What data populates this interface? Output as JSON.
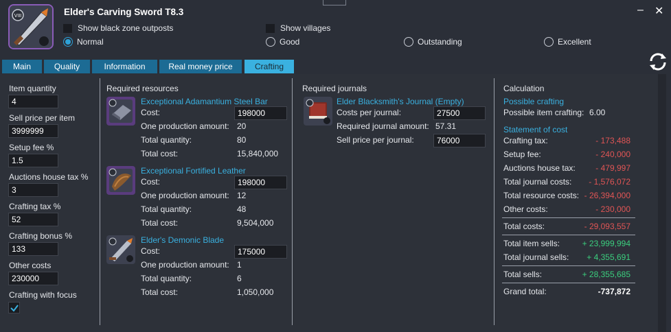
{
  "window": {
    "title": "Elder's Carving Sword T8.3",
    "tier_badge": "VIII",
    "minimize_glyph": "‒",
    "close_glyph": "✕"
  },
  "options": {
    "show_black_zone": "Show black zone outposts",
    "show_villages": "Show villages",
    "qualities": [
      "Normal",
      "Good",
      "Outstanding",
      "Excellent"
    ],
    "selected_quality": "Normal"
  },
  "tabs": [
    "Main",
    "Quality",
    "Information",
    "Real money price",
    "Crafting"
  ],
  "active_tab": "Crafting",
  "left": {
    "item_quantity_label": "Item quantity",
    "item_quantity": "4",
    "sell_price_label": "Sell price per item",
    "sell_price": "3999999",
    "setup_fee_label": "Setup fee %",
    "setup_fee": "1.5",
    "auction_tax_label": "Auctions house tax %",
    "auction_tax": "3",
    "crafting_tax_label": "Crafting tax %",
    "crafting_tax": "52",
    "crafting_bonus_label": "Crafting bonus %",
    "crafting_bonus": "133",
    "other_costs_label": "Other costs",
    "other_costs": "230000",
    "focus_label": "Crafting with focus",
    "focus_checked": true
  },
  "resources": {
    "heading": "Required resources",
    "cost_label": "Cost:",
    "one_prod_label": "One production amount:",
    "total_qty_label": "Total quantity:",
    "total_cost_label": "Total cost:",
    "items": [
      {
        "name": "Exceptional Adamantium Steel Bar",
        "cost": "198000",
        "one_prod": "20",
        "total_qty": "80",
        "total_cost": "15,840,000",
        "icon": "steel-bar-icon"
      },
      {
        "name": "Exceptional Fortified Leather",
        "cost": "198000",
        "one_prod": "12",
        "total_qty": "48",
        "total_cost": "9,504,000",
        "icon": "leather-icon"
      },
      {
        "name": "Elder's Demonic Blade",
        "cost": "175000",
        "one_prod": "1",
        "total_qty": "6",
        "total_cost": "1,050,000",
        "icon": "demonic-blade-icon"
      }
    ]
  },
  "journals": {
    "heading": "Required journals",
    "name": "Elder Blacksmith's Journal (Empty)",
    "cost_label": "Costs per journal:",
    "cost": "27500",
    "amount_label": "Required journal amount:",
    "amount": "57.31",
    "sell_label": "Sell price per journal:",
    "sell": "76000"
  },
  "calc": {
    "heading": "Calculation",
    "possible_heading": "Possible crafting",
    "possible_label": "Possible item crafting:",
    "possible_value": "6.00",
    "statement_heading": "Statement of cost",
    "rows": [
      {
        "label": "Crafting tax:",
        "value": "- 173,488"
      },
      {
        "label": "Setup fee:",
        "value": "- 240,000"
      },
      {
        "label": "Auctions house tax:",
        "value": "- 479,997"
      },
      {
        "label": "Total journal costs:",
        "value": "- 1,576,072"
      },
      {
        "label": "Total resource costs:",
        "value": "- 26,394,000"
      },
      {
        "label": "Other costs:",
        "value": "- 230,000"
      }
    ],
    "total_costs_label": "Total costs:",
    "total_costs": "- 29,093,557",
    "item_sells_label": "Total item sells:",
    "item_sells": "+ 23,999,994",
    "journal_sells_label": "Total journal sells:",
    "journal_sells": "+ 4,355,691",
    "total_sells_label": "Total sells:",
    "total_sells": "+ 28,355,685",
    "grand_total_label": "Grand total:",
    "grand_total": "-737,872"
  },
  "colors": {
    "accent": "#3ab1e0",
    "tab": "#1c6b94",
    "negative": "#e05555",
    "positive": "#3bcf7e"
  }
}
